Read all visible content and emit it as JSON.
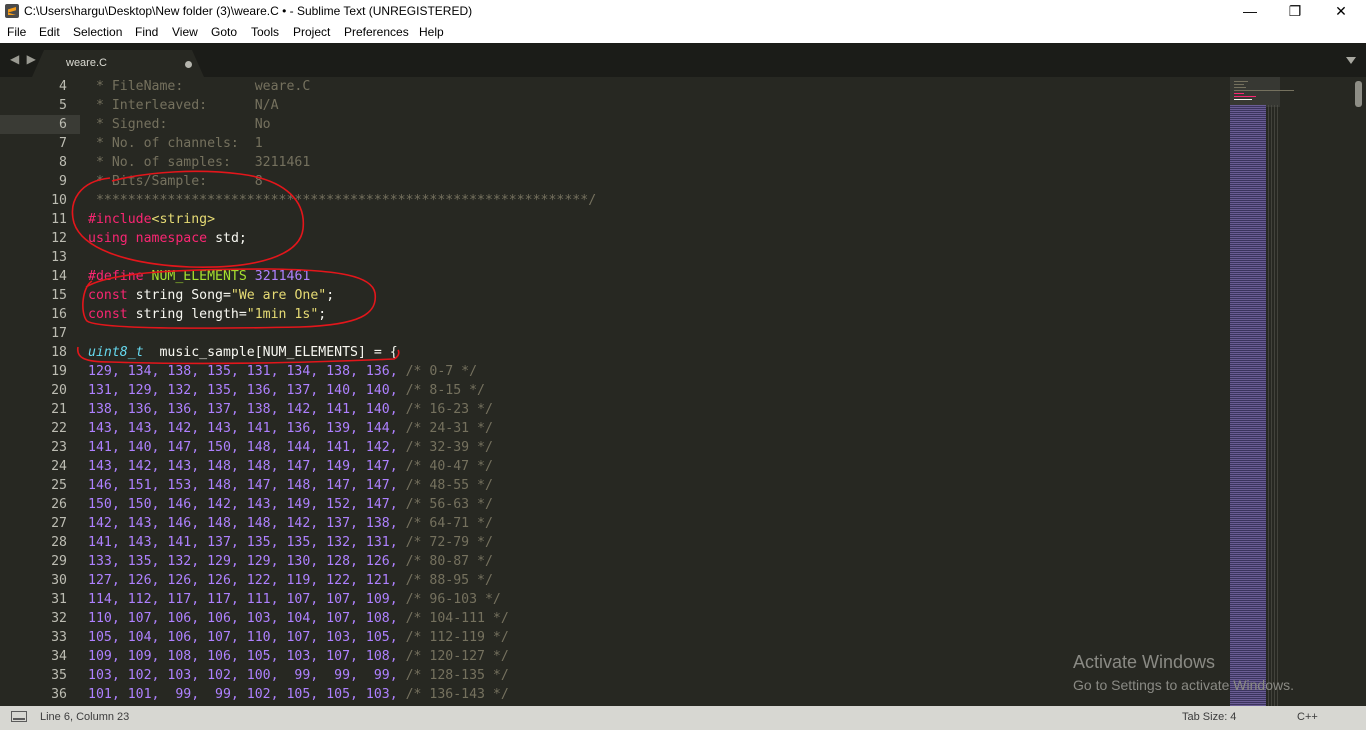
{
  "window": {
    "title": "C:\\Users\\hargu\\Desktop\\New folder (3)\\weare.C • - Sublime Text (UNREGISTERED)",
    "minimize_glyph": "—",
    "maximize_glyph": "❐",
    "close_glyph": "✕"
  },
  "menu": [
    "File",
    "Edit",
    "Selection",
    "Find",
    "View",
    "Goto",
    "Tools",
    "Project",
    "Preferences",
    "Help"
  ],
  "tabs": {
    "nav_arrows": "◀ ▶",
    "active": {
      "label": "weare.C",
      "modified": true
    }
  },
  "editor": {
    "current_line": 6,
    "lines": [
      {
        "num": "4",
        "tokens": [
          {
            "c": "tk-c",
            "t": " * FileName:         weare.C"
          }
        ]
      },
      {
        "num": "5",
        "tokens": [
          {
            "c": "tk-c",
            "t": " * Interleaved:      N/A"
          }
        ]
      },
      {
        "num": "6",
        "tokens": [
          {
            "c": "tk-c",
            "t": " * Signed:           No"
          }
        ]
      },
      {
        "num": "7",
        "tokens": [
          {
            "c": "tk-c",
            "t": " * No. of channels:  1"
          }
        ]
      },
      {
        "num": "8",
        "tokens": [
          {
            "c": "tk-c",
            "t": " * No. of samples:   3211461"
          }
        ]
      },
      {
        "num": "9",
        "tokens": [
          {
            "c": "tk-c",
            "t": " * Bits/Sample:      8"
          }
        ]
      },
      {
        "num": "10",
        "tokens": [
          {
            "c": "tk-c",
            "t": " **************************************************************/"
          }
        ]
      },
      {
        "num": "11",
        "tokens": [
          {
            "c": "tk-k",
            "t": "#include"
          },
          {
            "c": "tk-s",
            "t": "<string>"
          }
        ]
      },
      {
        "num": "12",
        "tokens": [
          {
            "c": "tk-k",
            "t": "using"
          },
          {
            "c": "tk-p",
            "t": " "
          },
          {
            "c": "tk-k",
            "t": "namespace"
          },
          {
            "c": "tk-p",
            "t": " std;"
          }
        ]
      },
      {
        "num": "13",
        "tokens": []
      },
      {
        "num": "14",
        "tokens": [
          {
            "c": "tk-k",
            "t": "#define"
          },
          {
            "c": "tk-p",
            "t": " "
          },
          {
            "c": "tk-g",
            "t": "NUM_ELEMENTS"
          },
          {
            "c": "tk-p",
            "t": " "
          },
          {
            "c": "tk-n",
            "t": "3211461"
          }
        ]
      },
      {
        "num": "15",
        "tokens": [
          {
            "c": "tk-k",
            "t": "const"
          },
          {
            "c": "tk-p",
            "t": " string Song="
          },
          {
            "c": "tk-s",
            "t": "\"We are One\""
          },
          {
            "c": "tk-p",
            "t": ";"
          }
        ]
      },
      {
        "num": "16",
        "tokens": [
          {
            "c": "tk-k",
            "t": "const"
          },
          {
            "c": "tk-p",
            "t": " string length="
          },
          {
            "c": "tk-s",
            "t": "\"1min 1s\""
          },
          {
            "c": "tk-p",
            "t": ";"
          }
        ]
      },
      {
        "num": "17",
        "tokens": []
      },
      {
        "num": "18",
        "tokens": [
          {
            "c": "tk-t",
            "t": "uint8_t"
          },
          {
            "c": "tk-p",
            "t": "  music_sample[NUM_ELEMENTS] = {"
          }
        ]
      },
      {
        "num": "19",
        "tokens": [
          {
            "c": "tk-n",
            "t": "129, 134, 138, 135, 131, 134, 138, 136, "
          },
          {
            "c": "tk-c",
            "t": "/* 0-7 */"
          }
        ]
      },
      {
        "num": "20",
        "tokens": [
          {
            "c": "tk-n",
            "t": "131, 129, 132, 135, 136, 137, 140, 140, "
          },
          {
            "c": "tk-c",
            "t": "/* 8-15 */"
          }
        ]
      },
      {
        "num": "21",
        "tokens": [
          {
            "c": "tk-n",
            "t": "138, 136, 136, 137, 138, 142, 141, 140, "
          },
          {
            "c": "tk-c",
            "t": "/* 16-23 */"
          }
        ]
      },
      {
        "num": "22",
        "tokens": [
          {
            "c": "tk-n",
            "t": "143, 143, 142, 143, 141, 136, 139, 144, "
          },
          {
            "c": "tk-c",
            "t": "/* 24-31 */"
          }
        ]
      },
      {
        "num": "23",
        "tokens": [
          {
            "c": "tk-n",
            "t": "141, 140, 147, 150, 148, 144, 141, 142, "
          },
          {
            "c": "tk-c",
            "t": "/* 32-39 */"
          }
        ]
      },
      {
        "num": "24",
        "tokens": [
          {
            "c": "tk-n",
            "t": "143, 142, 143, 148, 148, 147, 149, 147, "
          },
          {
            "c": "tk-c",
            "t": "/* 40-47 */"
          }
        ]
      },
      {
        "num": "25",
        "tokens": [
          {
            "c": "tk-n",
            "t": "146, 151, 153, 148, 147, 148, 147, 147, "
          },
          {
            "c": "tk-c",
            "t": "/* 48-55 */"
          }
        ]
      },
      {
        "num": "26",
        "tokens": [
          {
            "c": "tk-n",
            "t": "150, 150, 146, 142, 143, 149, 152, 147, "
          },
          {
            "c": "tk-c",
            "t": "/* 56-63 */"
          }
        ]
      },
      {
        "num": "27",
        "tokens": [
          {
            "c": "tk-n",
            "t": "142, 143, 146, 148, 148, 142, 137, 138, "
          },
          {
            "c": "tk-c",
            "t": "/* 64-71 */"
          }
        ]
      },
      {
        "num": "28",
        "tokens": [
          {
            "c": "tk-n",
            "t": "141, 143, 141, 137, 135, 135, 132, 131, "
          },
          {
            "c": "tk-c",
            "t": "/* 72-79 */"
          }
        ]
      },
      {
        "num": "29",
        "tokens": [
          {
            "c": "tk-n",
            "t": "133, 135, 132, 129, 129, 130, 128, 126, "
          },
          {
            "c": "tk-c",
            "t": "/* 80-87 */"
          }
        ]
      },
      {
        "num": "30",
        "tokens": [
          {
            "c": "tk-n",
            "t": "127, 126, 126, 126, 122, 119, 122, 121, "
          },
          {
            "c": "tk-c",
            "t": "/* 88-95 */"
          }
        ]
      },
      {
        "num": "31",
        "tokens": [
          {
            "c": "tk-n",
            "t": "114, 112, 117, 117, 111, 107, 107, 109, "
          },
          {
            "c": "tk-c",
            "t": "/* 96-103 */"
          }
        ]
      },
      {
        "num": "32",
        "tokens": [
          {
            "c": "tk-n",
            "t": "110, 107, 106, 106, 103, 104, 107, 108, "
          },
          {
            "c": "tk-c",
            "t": "/* 104-111 */"
          }
        ]
      },
      {
        "num": "33",
        "tokens": [
          {
            "c": "tk-n",
            "t": "105, 104, 106, 107, 110, 107, 103, 105, "
          },
          {
            "c": "tk-c",
            "t": "/* 112-119 */"
          }
        ]
      },
      {
        "num": "34",
        "tokens": [
          {
            "c": "tk-n",
            "t": "109, 109, 108, 106, 105, 103, 107, 108, "
          },
          {
            "c": "tk-c",
            "t": "/* 120-127 */"
          }
        ]
      },
      {
        "num": "35",
        "tokens": [
          {
            "c": "tk-n",
            "t": "103, 102, 103, 102, 100,  99,  99,  99, "
          },
          {
            "c": "tk-c",
            "t": "/* 128-135 */"
          }
        ]
      },
      {
        "num": "36",
        "tokens": [
          {
            "c": "tk-n",
            "t": "101, 101,  99,  99, 102, 105, 105, 103, "
          },
          {
            "c": "tk-c",
            "t": "/* 136-143 */"
          }
        ]
      }
    ]
  },
  "watermark": {
    "title": "Activate Windows",
    "subtitle": "Go to Settings to activate Windows."
  },
  "status": {
    "position": "Line 6, Column 23",
    "tab_size": "Tab Size: 4",
    "syntax": "C++"
  },
  "colors": {
    "editor_bg": "#272822",
    "keyword": "#f92672",
    "number": "#ae81ff",
    "string": "#e6db74",
    "comment": "#75715e",
    "annotation_circle": "#e3161b"
  }
}
